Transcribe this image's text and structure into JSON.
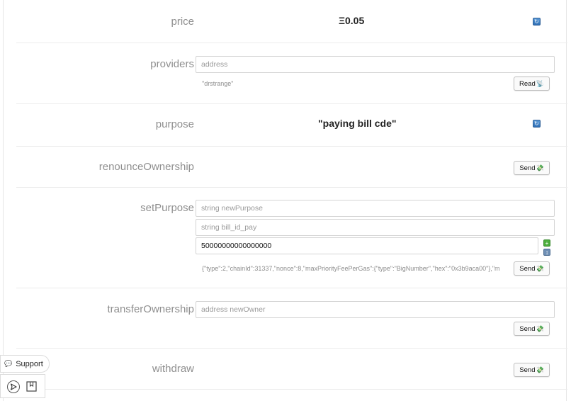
{
  "functions": {
    "price": {
      "label": "price",
      "value": "Ξ0.05"
    },
    "providers": {
      "label": "providers",
      "placeholder": "address",
      "result": "\"drstrange\"",
      "button": "Read"
    },
    "purpose": {
      "label": "purpose",
      "value": "\"paying bill cde\""
    },
    "renounceOwnership": {
      "label": "renounceOwnership",
      "button": "Send"
    },
    "setPurpose": {
      "label": "setPurpose",
      "input1_placeholder": "string newPurpose",
      "input2_placeholder": "string bill_id_pay",
      "input3_value": "50000000000000000",
      "result": "{\"type\":2,\"chainId\":31337,\"nonce\":8,\"maxPriorityFeePerGas\":{\"type\":\"BigNumber\",\"hex\":\"0x3b9aca00\"},\"m",
      "button": "Send"
    },
    "transferOwnership": {
      "label": "transferOwnership",
      "placeholder": "address newOwner",
      "button": "Send"
    },
    "withdraw": {
      "label": "withdraw",
      "button": "Send"
    }
  },
  "support": {
    "label": "Support"
  },
  "icons": {
    "refresh": "refresh-icon",
    "send": "send-icon",
    "read": "read-icon",
    "chat": "chat-icon",
    "paper-plane": "paper-plane-icon",
    "bookmark": "bookmark-icon"
  },
  "colors": {
    "refresh": "#3b7dc4",
    "stepper_up": "#4cae3c",
    "stepper_down": "#6f8fb5"
  }
}
